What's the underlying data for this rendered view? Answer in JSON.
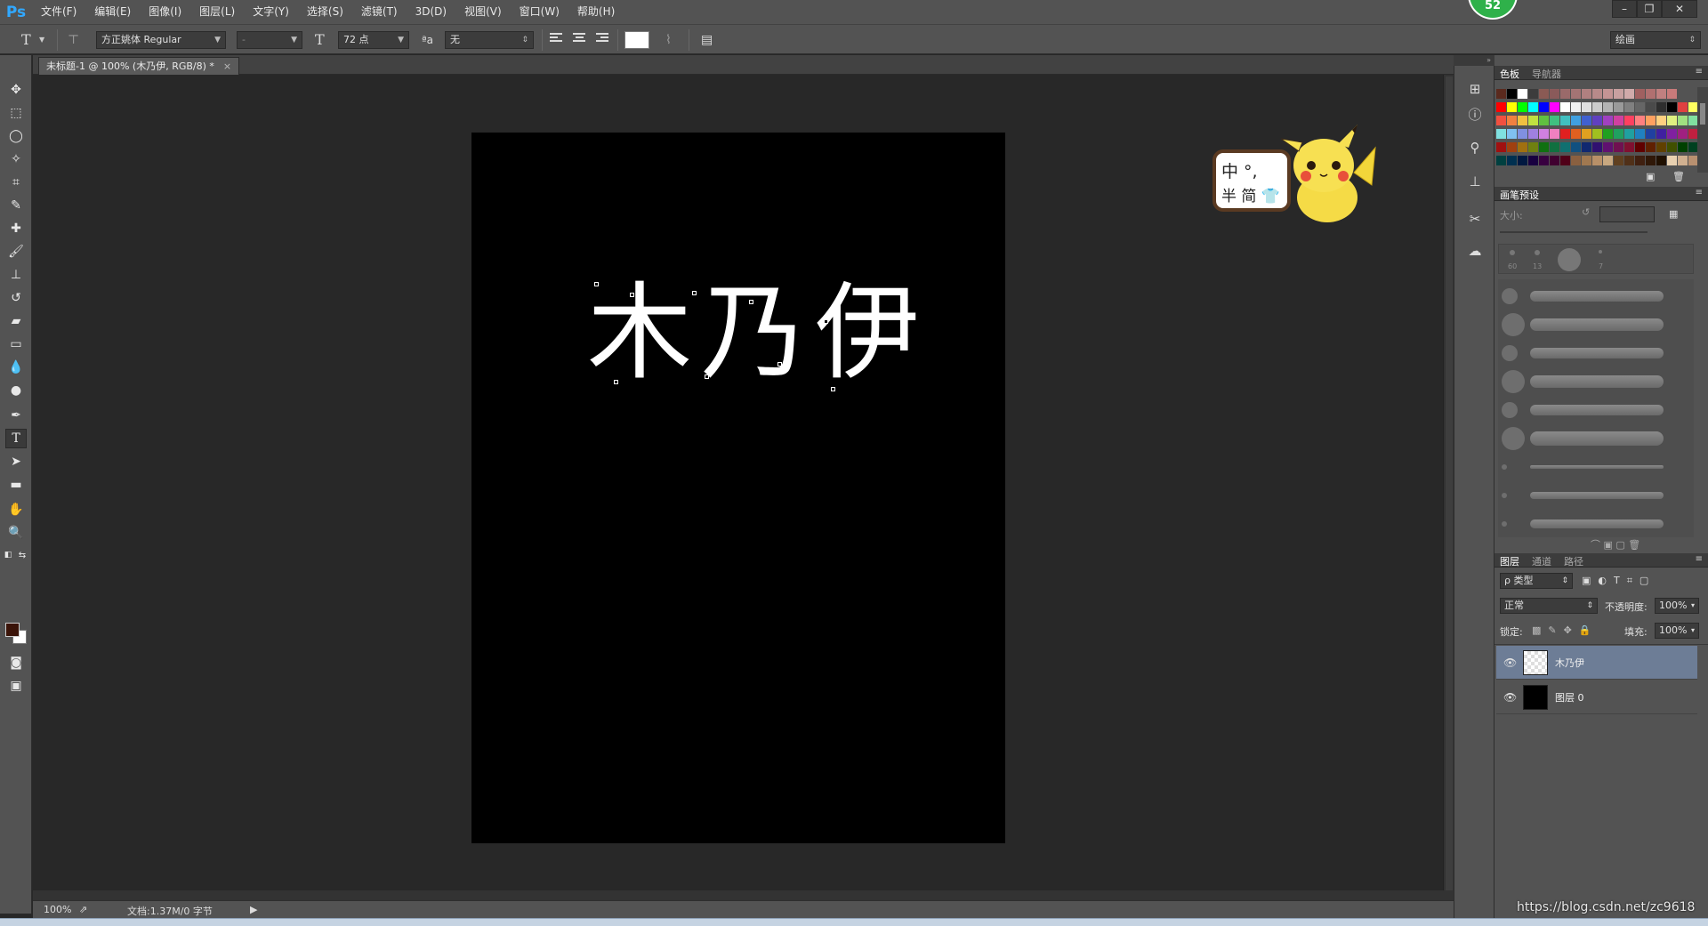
{
  "app": {
    "logo": "Ps",
    "badge": "52"
  },
  "menu": [
    "文件(F)",
    "编辑(E)",
    "图像(I)",
    "图层(L)",
    "文字(Y)",
    "选择(S)",
    "滤镜(T)",
    "3D(D)",
    "视图(V)",
    "窗口(W)",
    "帮助(H)"
  ],
  "window_controls": {
    "minimize": "–",
    "restore": "❐",
    "close": "✕"
  },
  "options": {
    "tool_icon": "T",
    "font_family": "方正姚体 Regular",
    "font_style": "-",
    "font_size": "72 点",
    "aa_label": "ªa",
    "antialias": "无",
    "workspace": "绘画"
  },
  "document": {
    "tab_title": "未标题-1 @ 100% (木乃伊, RGB/8) *",
    "tab_close": "×",
    "text": "木乃伊"
  },
  "status": {
    "zoom": "100%",
    "doc_info": "文档:1.37M/0 字节",
    "arrow": "▶"
  },
  "ime": {
    "line1": "中 °,",
    "line2": "半 简 👕"
  },
  "panels": {
    "color_tabs": [
      "色板",
      "导航器"
    ],
    "swatch_colors": [
      [
        "#5a2a1e",
        "#000000",
        "#ffffff",
        "#3c3c3c",
        "#8a5a54",
        "#8a5a5a",
        "#9a6a6a",
        "#a47474",
        "#b08080",
        "#b88a8a",
        "#c49494",
        "#c8a0a0",
        "#d0aaaa",
        "#a06060",
        "#b07070",
        "#c08080",
        "#c87a7a"
      ],
      [
        "#ff0000",
        "#ffff00",
        "#00ff00",
        "#00ffff",
        "#0000ff",
        "#ff00ff",
        "#ffffff",
        "#f0f0f0",
        "#e0e0e0",
        "#cccccc",
        "#b4b4b4",
        "#9a9a9a",
        "#808080",
        "#666666",
        "#4a4a4a",
        "#2e2e2e",
        "#000000",
        "#e04040",
        "#ffff60"
      ],
      [
        "#f05040",
        "#f08040",
        "#f0c040",
        "#c0e040",
        "#60c040",
        "#40c080",
        "#40c0c0",
        "#40a0e0",
        "#4060d0",
        "#6040c0",
        "#a040c0",
        "#d040a0",
        "#ff4060",
        "#ff8080",
        "#ffa060",
        "#ffd080",
        "#e0f080",
        "#a0e080",
        "#80e0a0"
      ],
      [
        "#80e0e0",
        "#80c0f0",
        "#8090e0",
        "#a080e0",
        "#d080e0",
        "#f080c0",
        "#e02020",
        "#e06020",
        "#e0a020",
        "#a0c020",
        "#20a020",
        "#20a060",
        "#20a0a0",
        "#2080c0",
        "#2040a0",
        "#4020a0",
        "#8020a0",
        "#a02080",
        "#c02040"
      ],
      [
        "#a01010",
        "#a04010",
        "#a07010",
        "#708010",
        "#107010",
        "#107040",
        "#107070",
        "#105080",
        "#102870",
        "#301070",
        "#601070",
        "#701050",
        "#801030",
        "#600000",
        "#602000",
        "#604000",
        "#405000",
        "#004000",
        "#004020"
      ],
      [
        "#004040",
        "#003050",
        "#001840",
        "#180040",
        "#380040",
        "#400030",
        "#500018",
        "#8a6040",
        "#a07850",
        "#b89068",
        "#c8a880",
        "#604020",
        "#503018",
        "#402010",
        "#301808",
        "#201000",
        "#e8d0b0",
        "#d0b090",
        "#b89070"
      ]
    ],
    "brush_tab": "画笔预设",
    "brush_size_label": "大小:",
    "brush_nums": [
      "60",
      "13",
      "",
      "7"
    ],
    "layers_tabs": [
      "图层",
      "通道",
      "路径"
    ],
    "filter": "ρ 类型",
    "blend_mode": "正常",
    "opacity_label": "不透明度:",
    "opacity": "100%",
    "lock_label": "锁定:",
    "fill_label": "填充:",
    "fill": "100%",
    "layers": [
      {
        "name": "木乃伊",
        "selected": true
      },
      {
        "name": "图层 0",
        "selected": false
      }
    ]
  },
  "watermark": "https://blog.csdn.net/zc9618"
}
